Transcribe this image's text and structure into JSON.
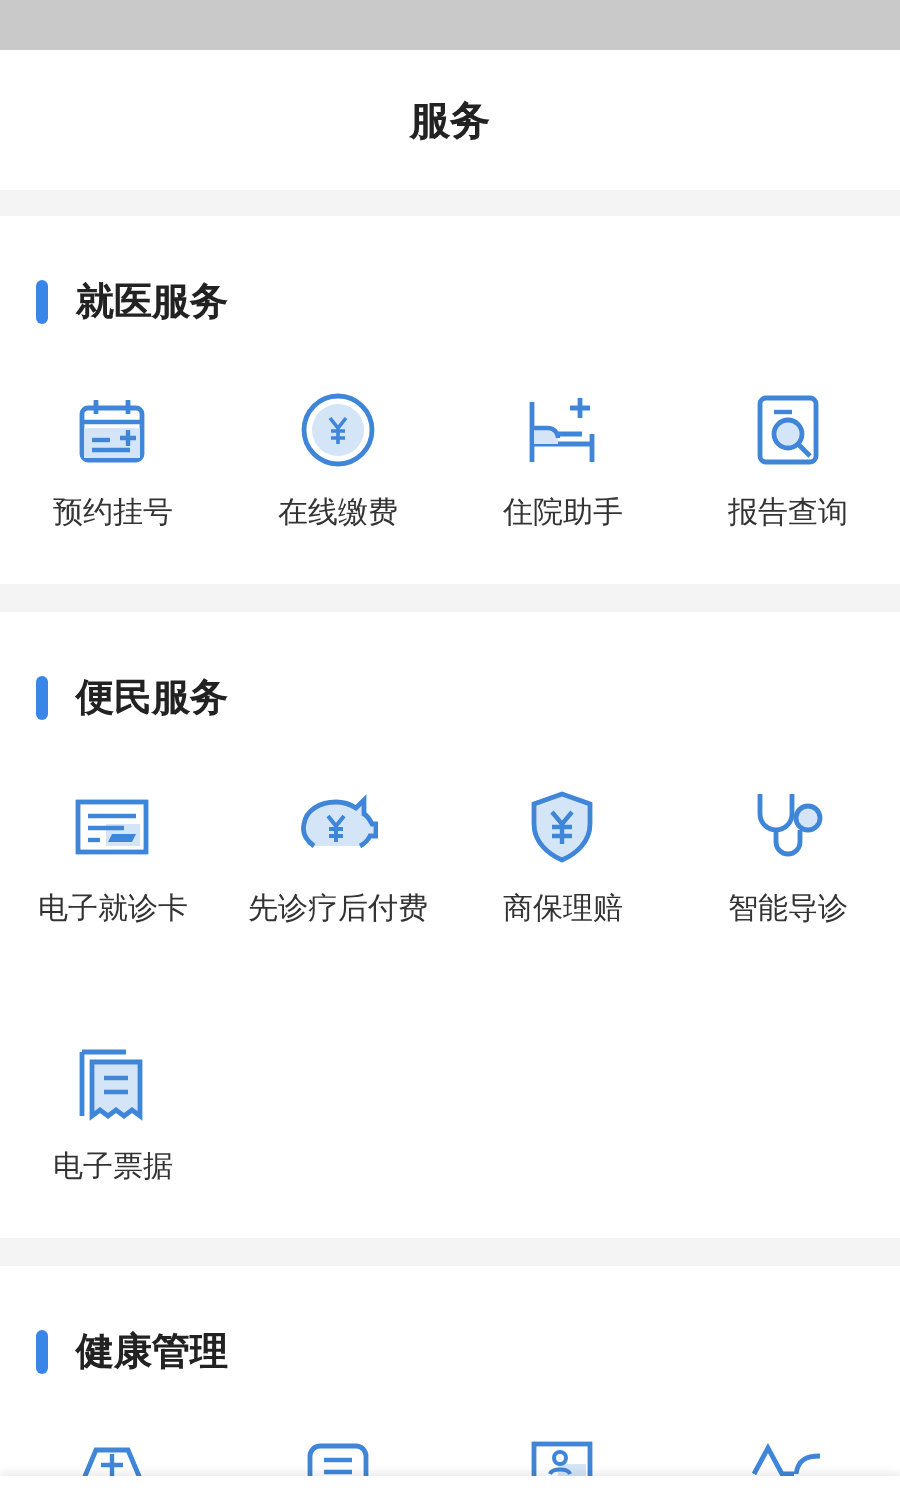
{
  "header": {
    "title": "服务"
  },
  "sections": [
    {
      "title": "就医服务",
      "items": [
        {
          "label": "预约挂号",
          "kind": "calendar"
        },
        {
          "label": "在线缴费",
          "kind": "coin"
        },
        {
          "label": "住院助手",
          "kind": "bed"
        },
        {
          "label": "报告查询",
          "kind": "report"
        }
      ]
    },
    {
      "title": "便民服务",
      "items": [
        {
          "label": "电子就诊卡",
          "kind": "card"
        },
        {
          "label": "先诊疗后付费",
          "kind": "piggy"
        },
        {
          "label": "商保理赔",
          "kind": "shield"
        },
        {
          "label": "智能导诊",
          "kind": "stethoscope"
        },
        {
          "label": "电子票据",
          "kind": "receipt"
        }
      ]
    },
    {
      "title": "健康管理",
      "items": [
        {
          "kind": "kit"
        },
        {
          "kind": "document"
        },
        {
          "kind": "person-card"
        },
        {
          "kind": "wave"
        }
      ]
    }
  ]
}
